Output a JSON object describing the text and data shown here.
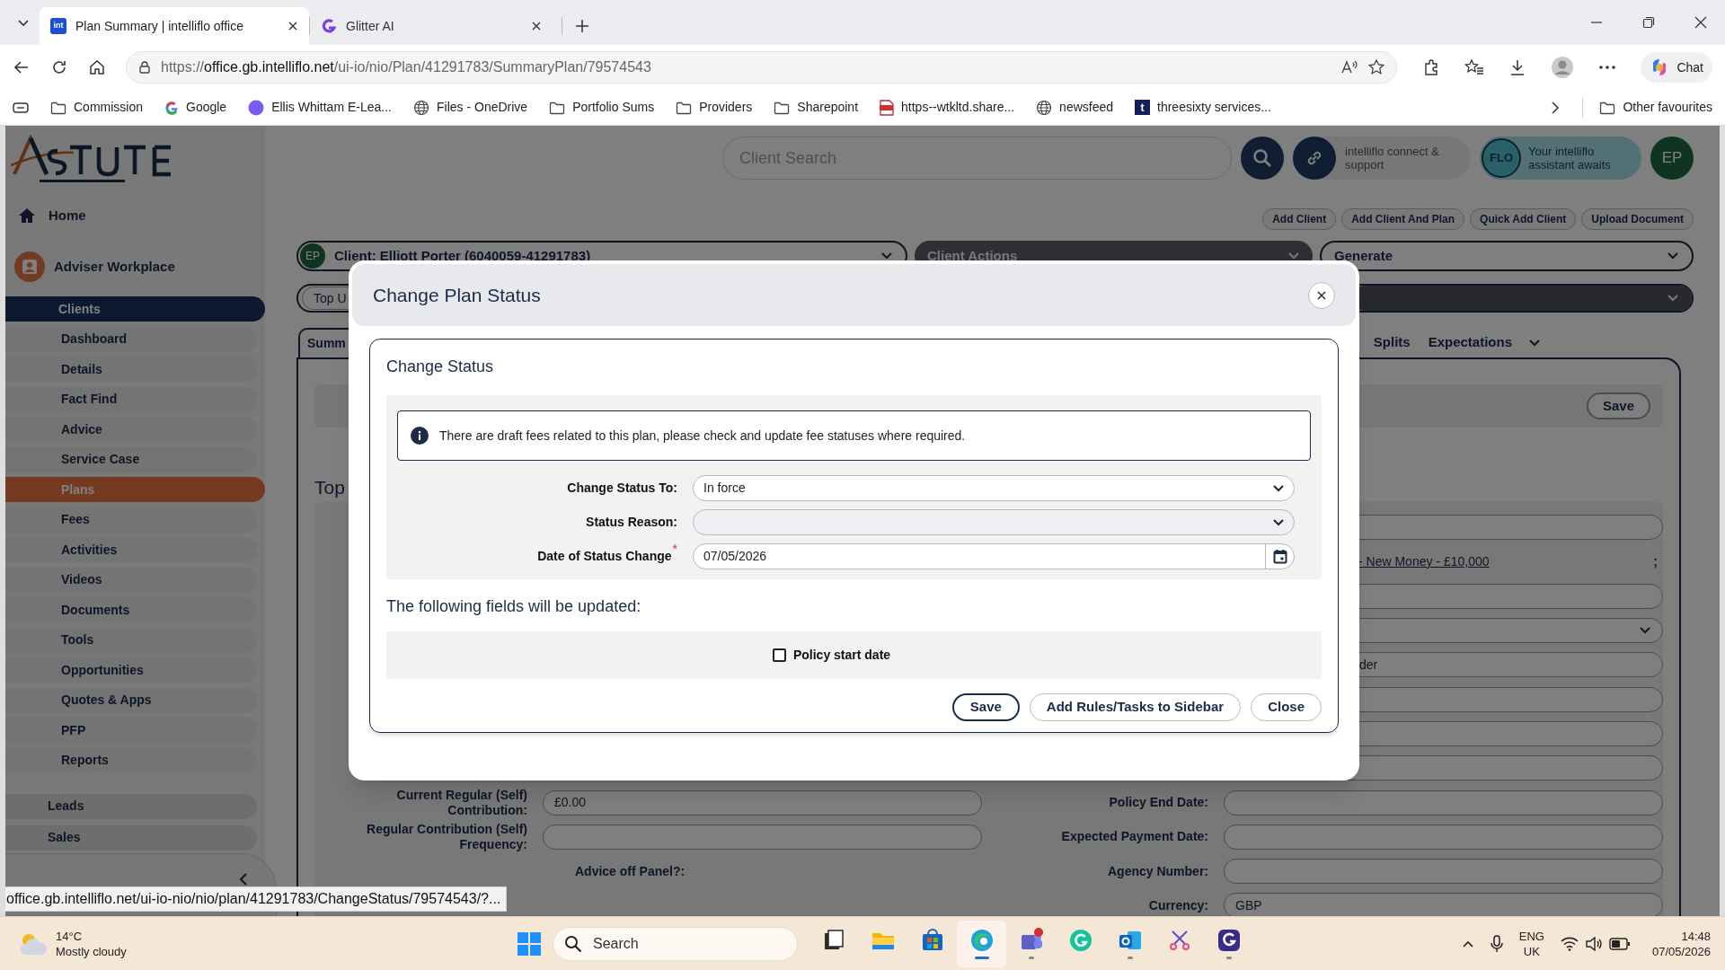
{
  "browser": {
    "tabs": [
      {
        "title": "Plan Summary | intelliflo office",
        "selected": true,
        "kind": "intelliflo",
        "icon_text": "int"
      },
      {
        "title": "Glitter AI",
        "selected": false,
        "kind": "glitter"
      }
    ],
    "url_scheme": "https://",
    "url_host": "office.gb.intelliflo.net",
    "url_path": "/ui-io/nio/Plan/41291783/SummaryPlan/79574543",
    "chat": "Chat",
    "bookmarks": [
      {
        "label": "Commission",
        "kind": "folder"
      },
      {
        "label": "Google",
        "kind": "google"
      },
      {
        "label": "Ellis Whittam E-Lea...",
        "kind": "badge"
      },
      {
        "label": "Files - OneDrive",
        "kind": "globe"
      },
      {
        "label": "Portfolio Sums",
        "kind": "folder"
      },
      {
        "label": "Providers",
        "kind": "folder"
      },
      {
        "label": "Sharepoint",
        "kind": "folder"
      },
      {
        "label": "https--wtkltd.share...",
        "kind": "pdf"
      },
      {
        "label": "newsfeed",
        "kind": "globe"
      },
      {
        "label": "threesixty services...",
        "kind": "letter",
        "icon_text": "t"
      }
    ],
    "other_bookmarks": "Other favourites"
  },
  "header": {
    "search_placeholder": "Client Search",
    "connect": "intelliflo connect & support",
    "flo_badge": "FLO",
    "flo_text": "Your intelliflo assistant awaits",
    "avatar": "EP",
    "buttons": [
      "Add Client",
      "Add Client And Plan",
      "Quick Add Client",
      "Upload Document"
    ]
  },
  "sidebar": {
    "home": "Home",
    "workplace": "Adviser Workplace",
    "items": [
      {
        "label": "Clients",
        "selected": true,
        "kind": "section"
      },
      {
        "label": "Dashboard",
        "selected": false,
        "kind": "item"
      },
      {
        "label": "Details",
        "selected": false,
        "kind": "item"
      },
      {
        "label": "Fact Find",
        "selected": false,
        "kind": "item"
      },
      {
        "label": "Advice",
        "selected": false,
        "kind": "item"
      },
      {
        "label": "Service Case",
        "selected": false,
        "kind": "item"
      },
      {
        "label": "Plans",
        "selected": true,
        "kind": "item"
      },
      {
        "label": "Fees",
        "selected": false,
        "kind": "item"
      },
      {
        "label": "Activities",
        "selected": false,
        "kind": "item"
      },
      {
        "label": "Videos",
        "selected": false,
        "kind": "item"
      },
      {
        "label": "Documents",
        "selected": false,
        "kind": "item"
      },
      {
        "label": "Tools",
        "selected": false,
        "kind": "item"
      },
      {
        "label": "Opportunities",
        "selected": false,
        "kind": "item"
      },
      {
        "label": "Quotes & Apps",
        "selected": false,
        "kind": "item"
      },
      {
        "label": "PFP",
        "selected": false,
        "kind": "item"
      },
      {
        "label": "Reports",
        "selected": false,
        "kind": "item"
      }
    ],
    "extra": [
      "Leads",
      "Sales"
    ]
  },
  "client_bar": {
    "avatar": "EP",
    "client": "Client: Elliott Porter (6040059-41291783)",
    "actions": "Client Actions",
    "generate": "Generate"
  },
  "plan_bar": {
    "plan": "Top U"
  },
  "plan_tabs": [
    {
      "label": "Summ",
      "selected": true
    },
    {
      "label": "Splits",
      "selected": false
    },
    {
      "label": "Expectations",
      "selected": false
    }
  ],
  "panel": {
    "save": "Save",
    "heading": "Top",
    "rows": [
      {
        "right": {
          "kind": "field"
        }
      },
      {
        "right": {
          "kind": "link",
          "value": "- New Money - £10,000",
          "suffix": ";"
        }
      },
      {
        "right": {
          "kind": "field"
        }
      },
      {
        "right": {
          "kind": "select"
        }
      },
      {
        "right": {
          "kind": "field",
          "value": "der"
        }
      },
      {
        "right": {
          "kind": "field"
        }
      },
      {
        "right": {
          "kind": "field"
        }
      },
      {
        "right": {
          "kind": "field"
        }
      },
      {
        "left": {
          "kind": "field",
          "label": "Current Regular (Self) Contribution:",
          "value": "£0.00"
        },
        "right": {
          "kind": "field",
          "label": "Policy End Date:"
        }
      },
      {
        "left": {
          "kind": "field",
          "label": "Regular Contribution (Self) Frequency:"
        },
        "right": {
          "kind": "field",
          "label": "Expected Payment Date:"
        }
      },
      {
        "left": {
          "kind": "text",
          "value": "Advice off Panel?:"
        },
        "right": {
          "kind": "field",
          "label": "Agency Number:"
        }
      },
      {
        "right": {
          "kind": "field",
          "label": "Currency:",
          "value": "GBP"
        }
      }
    ]
  },
  "modal": {
    "title": "Change Plan Status",
    "section": "Change Status",
    "info": "There are draft fees related to this plan, please check and update fee statuses where required.",
    "fields": [
      {
        "label": "Change Status To:",
        "kind": "select",
        "value": "In force"
      },
      {
        "label": "Status Reason:",
        "kind": "select"
      },
      {
        "label": "Date of Status Change",
        "kind": "date",
        "value": "07/05/2026",
        "required_mark": "*"
      }
    ],
    "updated_title": "The following fields will be updated:",
    "checkboxes": [
      {
        "label": "Policy start date",
        "checked": false
      }
    ],
    "buttons": [
      {
        "label": "Save",
        "kind": "primary"
      },
      {
        "label": "Add Rules/Tasks to Sidebar",
        "kind": "secondary"
      },
      {
        "label": "Close",
        "kind": "secondary"
      }
    ]
  },
  "status_url": "office.gb.intelliflo.net/ui-io-nio/nio/plan/41291783/ChangeStatus/79574543/?...",
  "taskbar": {
    "temp": "14°C",
    "weather": "Mostly cloudy",
    "search": "Search",
    "apps": [
      {
        "kind": "explorer-dark",
        "running": false,
        "active": false
      },
      {
        "kind": "folder",
        "running": false,
        "active": false
      },
      {
        "kind": "store",
        "running": false,
        "active": false
      },
      {
        "kind": "edge",
        "running": true,
        "active": true
      },
      {
        "kind": "teams",
        "running": true,
        "active": false
      },
      {
        "kind": "grammarly",
        "running": false,
        "active": false
      },
      {
        "kind": "outlook",
        "running": true,
        "active": false
      },
      {
        "kind": "snip",
        "running": false,
        "active": false
      },
      {
        "kind": "glitter",
        "running": true,
        "active": false
      }
    ],
    "lang": "ENG",
    "region": "UK",
    "time": "14:48",
    "date": "07/05/2026"
  }
}
